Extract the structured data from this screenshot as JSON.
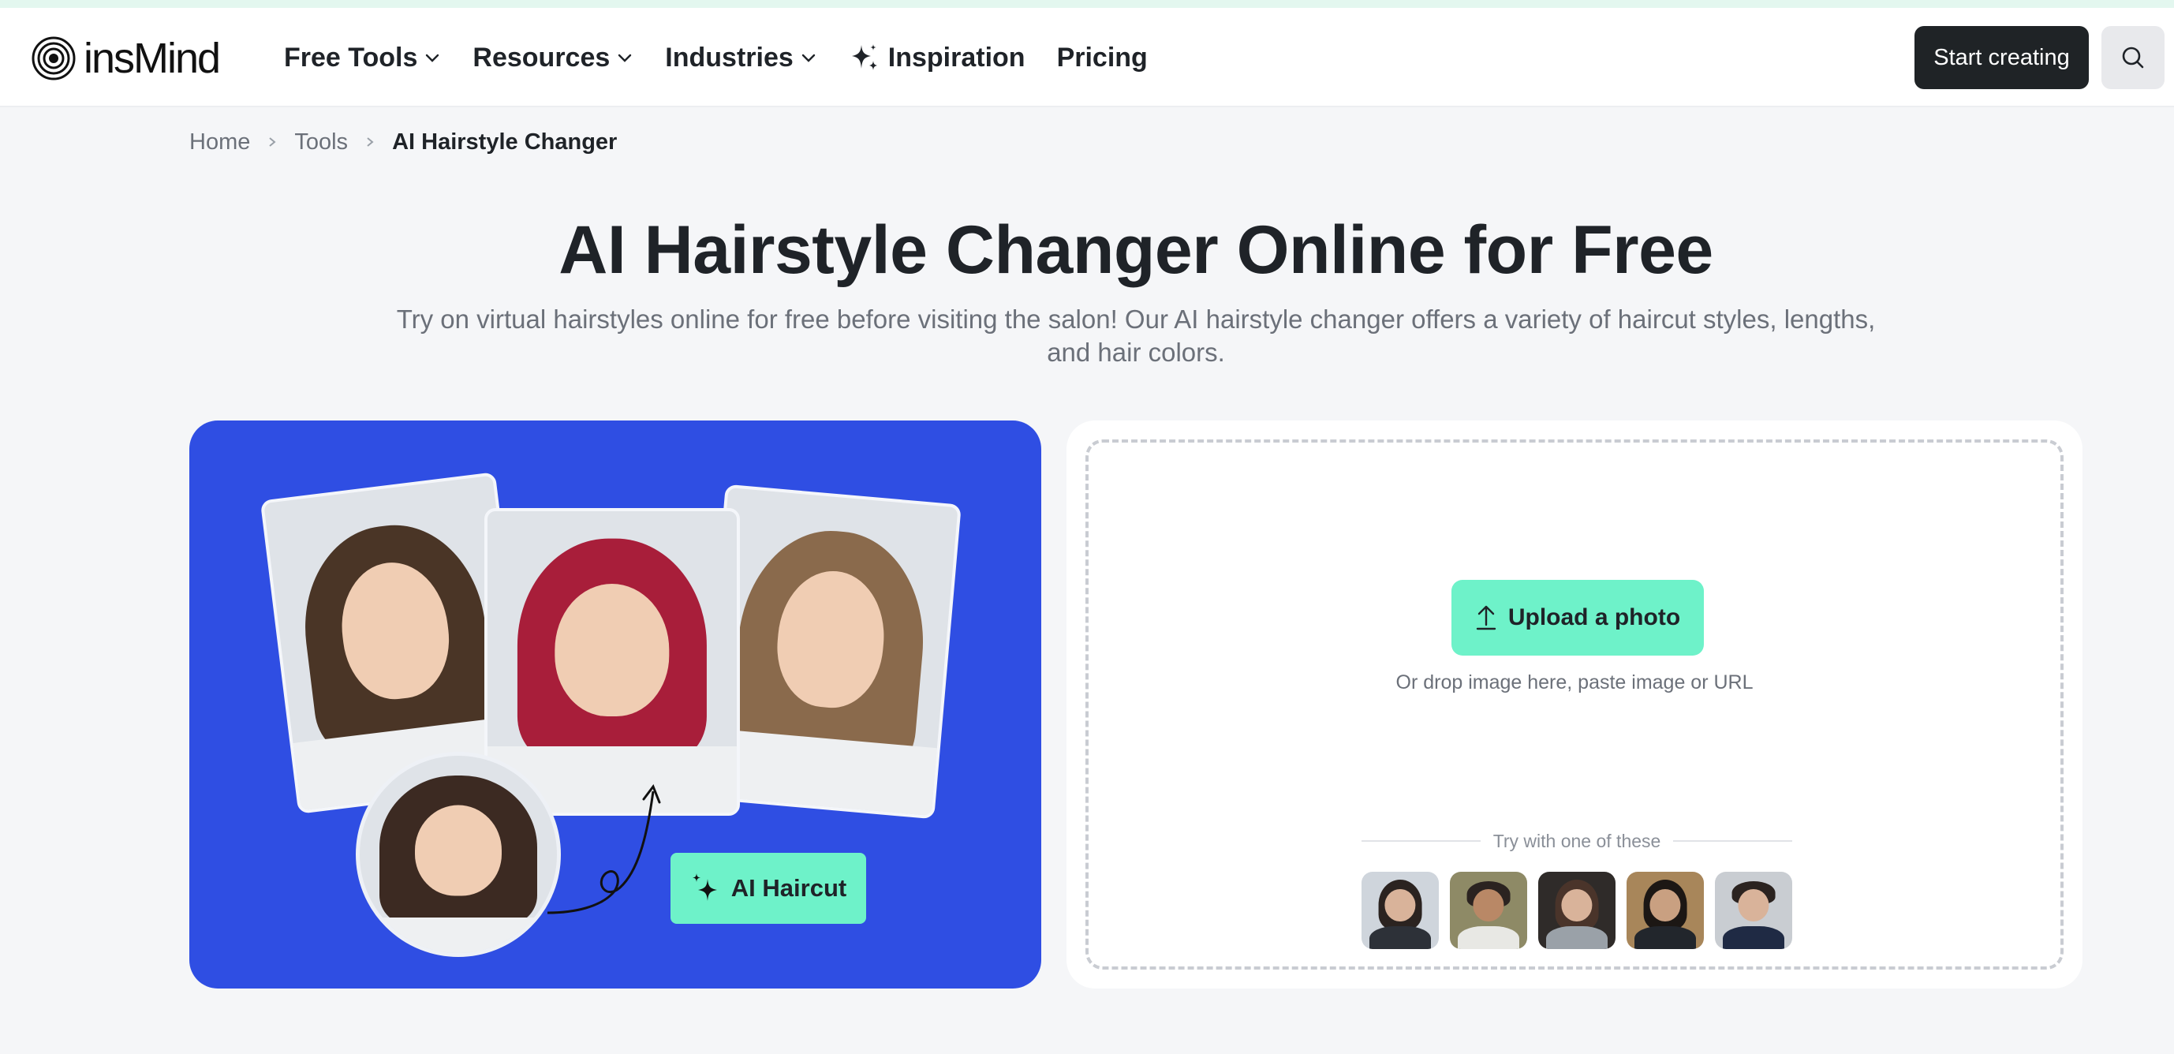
{
  "header": {
    "logo_text": "insMind",
    "nav": [
      {
        "label": "Free Tools",
        "has_dropdown": true
      },
      {
        "label": "Resources",
        "has_dropdown": true
      },
      {
        "label": "Industries",
        "has_dropdown": true
      },
      {
        "label": "Inspiration",
        "icon": "sparkle-icon"
      },
      {
        "label": "Pricing"
      }
    ],
    "start_button": "Start creating",
    "search_icon": "search-icon"
  },
  "breadcrumb": [
    "Home",
    "Tools",
    "AI Hairstyle Changer"
  ],
  "hero": {
    "title": "AI Hairstyle Changer Online for Free",
    "subtitle": "Try on virtual hairstyles online for free before visiting the salon! Our AI hairstyle changer offers a variety of haircut styles, lengths, and hair colors."
  },
  "showcase": {
    "badge": "AI Haircut",
    "accent_color": "#2f4ee3",
    "badge_color": "#6ef2c9"
  },
  "upload": {
    "button_label": "Upload a photo",
    "hint": "Or drop image here, paste image or URL",
    "samples_label": "Try with one of these",
    "sample_count": 5
  },
  "colors": {
    "primary_dark": "#1f2326",
    "mint": "#6ef2c9",
    "background": "#f5f6f8"
  }
}
